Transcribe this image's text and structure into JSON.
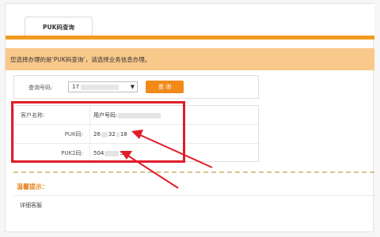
{
  "tab": {
    "label": "PUK码查询"
  },
  "notice": {
    "text": "您选择办理的是‘PUK码查询’，请选择业务信息办理。"
  },
  "query": {
    "label": "查询号码:",
    "selected_prefix": "17",
    "button_label": "查 询"
  },
  "result": {
    "rows": [
      {
        "label": "客户名称:",
        "value": "用户号码:"
      },
      {
        "label": "PUK码:",
        "value_start": "26",
        "value_mid": "32",
        "value_end": "18"
      },
      {
        "label": "PUK2码:",
        "value_start": "504",
        "value_end": "50"
      }
    ]
  },
  "tips": {
    "title": "温馨提示：",
    "body": "详细客服"
  },
  "colors": {
    "accent": "#f29a1e",
    "highlight": "#e11d2a",
    "notice_bg": "#f9c88b"
  }
}
